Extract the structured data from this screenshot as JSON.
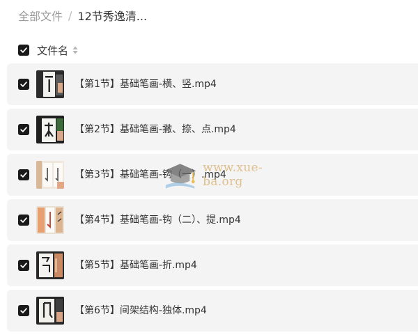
{
  "breadcrumb": {
    "root": "全部文件",
    "separator": "/",
    "current": "12节秀逸清..."
  },
  "list_header": {
    "column_label": "文件名",
    "checked": true
  },
  "files": [
    {
      "name": "【第1节】基础笔画-横、竖.mp4",
      "checked": true,
      "thumb_icon": "calligraphy-video-thumbnail"
    },
    {
      "name": "【第2节】基础笔画-撇、捺、点.mp4",
      "checked": true,
      "thumb_icon": "calligraphy-video-thumbnail"
    },
    {
      "name": "【第3节】基础笔画-钩（一）.mp4",
      "checked": true,
      "thumb_icon": "calligraphy-video-thumbnail"
    },
    {
      "name": "【第4节】基础笔画-钩（二）、提.mp4",
      "checked": true,
      "thumb_icon": "calligraphy-video-thumbnail"
    },
    {
      "name": "【第5节】基础笔画-折.mp4",
      "checked": true,
      "thumb_icon": "calligraphy-video-thumbnail"
    },
    {
      "name": "【第6节】间架结构-独体.mp4",
      "checked": true,
      "thumb_icon": "calligraphy-video-thumbnail"
    }
  ],
  "watermark": {
    "text": "www.xue-ba.org",
    "icon": "graduation-cap-icon"
  },
  "colors": {
    "row_background": "#f4f4f5",
    "checkbox": "#1a1a1a",
    "breadcrumb_root": "#9a9a9a"
  }
}
